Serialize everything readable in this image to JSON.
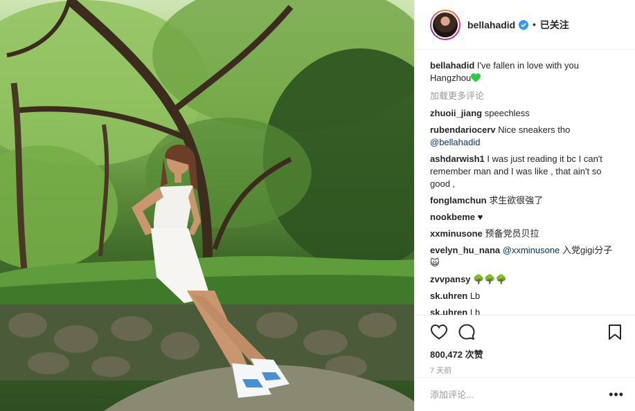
{
  "header": {
    "username": "bellahadid",
    "separator": "•",
    "follow_label": "已关注"
  },
  "caption": {
    "username": "bellahadid",
    "text": "I've fallen in love with you Hangzhou"
  },
  "load_more_label": "加载更多评论",
  "comments": [
    {
      "user": "zhuoii_jiang",
      "text": "speechless"
    },
    {
      "user": "rubendariocerv",
      "text": "Nice sneakers tho",
      "mention": "@bellahadid"
    },
    {
      "user": "ashdarwish1",
      "text": "I was just reading it bc I can't remember man and I was like , that ain't so good ,"
    },
    {
      "user": "fonglamchun",
      "text": "求生欲很強了"
    },
    {
      "user": "nookbeme",
      "text": "♥"
    },
    {
      "user": "xxminusone",
      "text": "预备党员贝拉"
    },
    {
      "user": "evelyn_hu_nana",
      "mention": "@xxminusone",
      "text": "入党gigi分子🙀"
    },
    {
      "user": "zvvpansy",
      "text": "🌳🌳🌳"
    },
    {
      "user": "sk.uhren",
      "text": "Lb"
    },
    {
      "user": "sk.uhren",
      "text": "Lb"
    }
  ],
  "likes": {
    "count": "800,472",
    "label": "次赞"
  },
  "time_label": "7 天前",
  "add_comment": {
    "placeholder": "添加评论..."
  },
  "more_label": "•••",
  "icons": {
    "like": "heart-icon",
    "comment": "comment-icon",
    "save": "bookmark-icon",
    "verified": "verified-badge-icon"
  },
  "colors": {
    "verified": "#3897f0",
    "heart_emoji": "#2ecc40",
    "mention": "#003569",
    "muted": "#999999"
  }
}
